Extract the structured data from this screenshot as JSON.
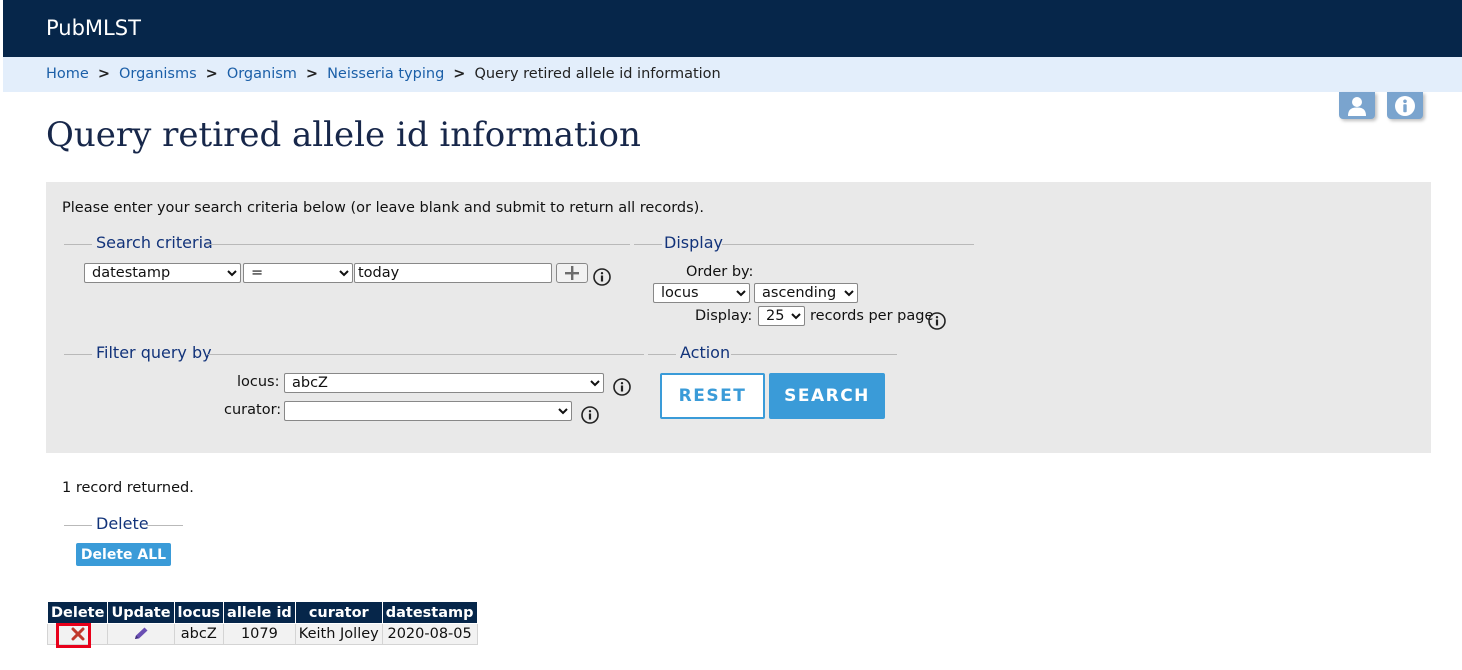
{
  "header": {
    "brand": "PubMLST"
  },
  "breadcrumb": {
    "items": [
      "Home",
      "Organisms",
      "Organism",
      "Neisseria typing"
    ],
    "separator": ">",
    "current": "Query retired allele id information"
  },
  "corner_buttons": {
    "user_icon": "user-icon",
    "info_icon": "info-icon"
  },
  "page": {
    "title": "Query retired allele id information"
  },
  "search_form": {
    "intro": "Please enter your search criteria below (or leave blank and submit to return all records).",
    "search_criteria": {
      "legend": "Search criteria",
      "field": "datestamp",
      "operator": "=",
      "value": "today"
    },
    "display": {
      "legend": "Display",
      "order_by_label": "Order by:",
      "order_by_field": "locus",
      "order_direction": "ascending",
      "display_label": "Display:",
      "per_page": "25",
      "per_page_suffix": "records per page"
    },
    "filter": {
      "legend": "Filter query by",
      "locus_label": "locus:",
      "locus_value": "abcZ",
      "curator_label": "curator:",
      "curator_value": ""
    },
    "action": {
      "legend": "Action",
      "reset_label": "RESET",
      "search_label": "SEARCH"
    }
  },
  "results": {
    "summary": "1 record returned.",
    "delete_legend": "Delete",
    "delete_all_label": "Delete ALL",
    "columns": [
      "Delete",
      "Update",
      "locus",
      "allele id",
      "curator",
      "datestamp"
    ],
    "rows": [
      {
        "locus": "abcZ",
        "allele_id": "1079",
        "curator": "Keith Jolley",
        "datestamp": "2020-08-05"
      }
    ]
  },
  "colors": {
    "navy": "#06264a",
    "breadcrumb_bg": "#e3eefb",
    "accent_blue": "#3a9bd8",
    "delete_red": "#c0392b",
    "highlight_red": "#e8001a",
    "pencil_purple": "#6a4fb3"
  }
}
